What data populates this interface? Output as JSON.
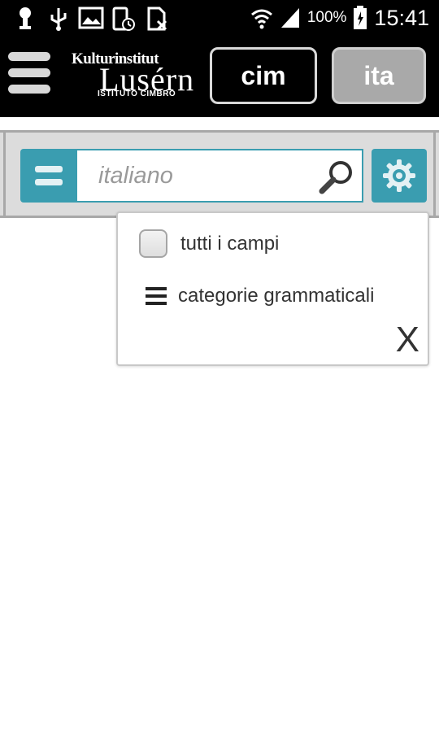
{
  "status_bar": {
    "battery_pct": "100%",
    "time": "15:41",
    "icons": [
      "notification-icon",
      "usb-icon",
      "image-icon",
      "phone-clock-icon",
      "document-icon",
      "wifi-icon",
      "signal-icon",
      "battery-icon"
    ]
  },
  "app_bar": {
    "logo": {
      "line1": "Kulturinstitut",
      "line2": "Lusérn",
      "line3": "ISTITUTO CIMBRO"
    },
    "lang_buttons": [
      {
        "label": "cim",
        "active": true
      },
      {
        "label": "ita",
        "active": false
      }
    ]
  },
  "search": {
    "placeholder": "italiano",
    "value": ""
  },
  "options_popup": {
    "all_fields_label": "tutti i campi",
    "all_fields_checked": false,
    "grammar_label": "categorie grammaticali",
    "close_label": "X"
  },
  "colors": {
    "accent": "#3a9db0",
    "bar_bg": "#000000",
    "search_area_bg": "#dcdcdc"
  }
}
